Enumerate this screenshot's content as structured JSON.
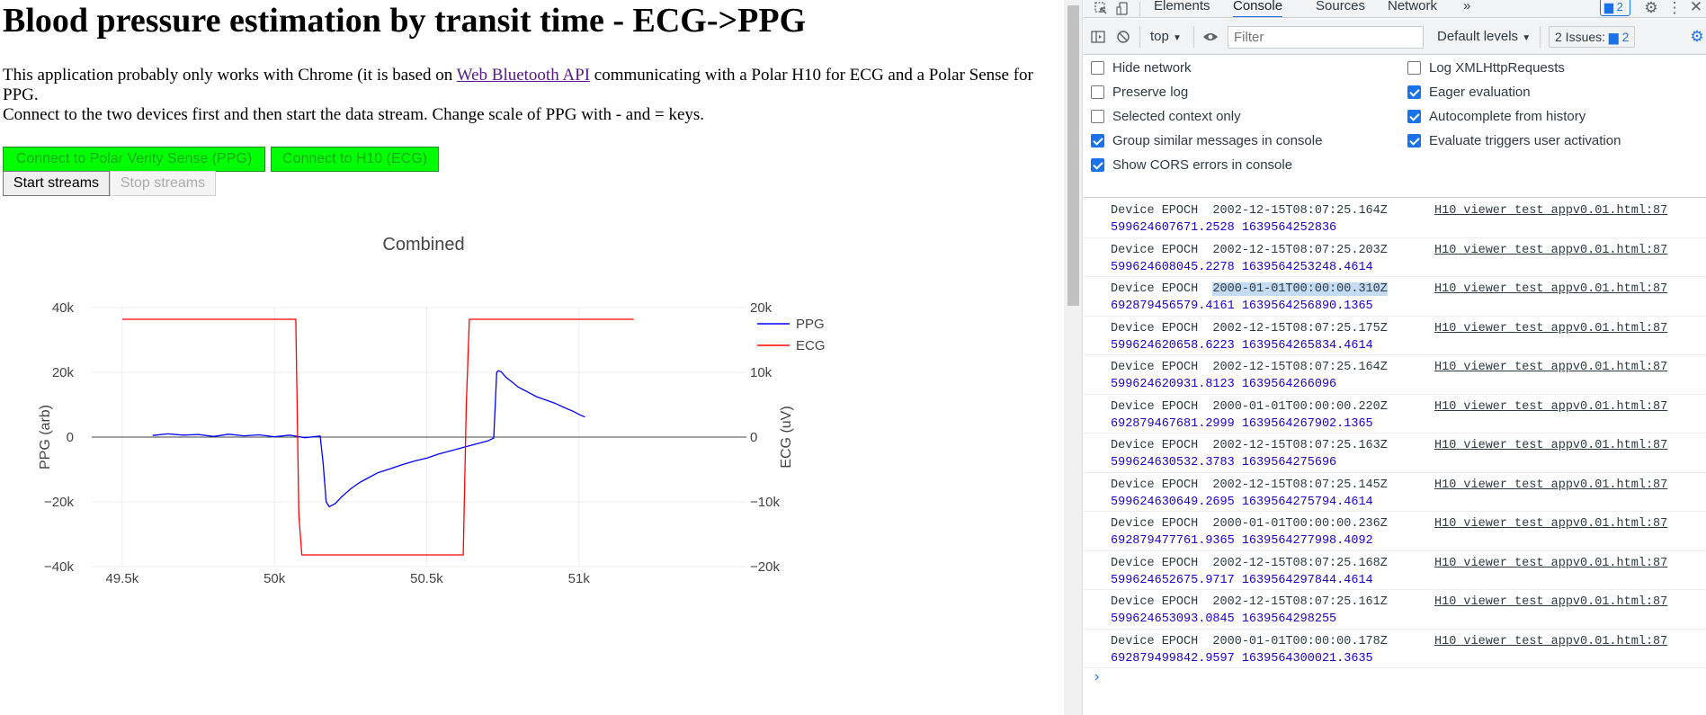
{
  "page": {
    "title": "Blood pressure estimation by transit time - ECG->PPG",
    "intro_part1": "This application probably only works with Chrome (it is based on ",
    "intro_link": "Web Bluetooth API",
    "intro_part2": " communicating with a Polar H10 for ECG and a Polar Sense for PPG.",
    "intro_line2": "Connect to the two devices first and then start the data stream. Change scale of PPG with - and = keys.",
    "btn_connect_ppg": "Connect to Polar Verity Sense (PPG)",
    "btn_connect_ecg": "Connect to H10 (ECG)",
    "btn_start": "Start streams",
    "btn_stop": "Stop streams",
    "accent_green": "#00ff00"
  },
  "chart_data": {
    "type": "line",
    "title": "Combined",
    "xlabel": "",
    "ylabel": "PPG (arb)",
    "y2label": "ECG (uV)",
    "xlim": [
      49400,
      51550
    ],
    "ylim": [
      -40000,
      40000
    ],
    "y2lim": [
      -20000,
      20000
    ],
    "x_ticks": [
      49500,
      50000,
      50500,
      51000
    ],
    "x_tick_labels": [
      "49.5k",
      "50k",
      "50.5k",
      "51k"
    ],
    "y_ticks": [
      -40000,
      -20000,
      0,
      20000,
      40000
    ],
    "y_tick_labels": [
      "−40k",
      "−20k",
      "0",
      "20k",
      "40k"
    ],
    "y2_ticks": [
      -20000,
      -10000,
      0,
      10000,
      20000
    ],
    "y2_tick_labels": [
      "−20k",
      "−10k",
      "0",
      "10k",
      "20k"
    ],
    "legend": "top-right",
    "series": [
      {
        "name": "PPG",
        "color": "#0000ff",
        "axis": "y",
        "x": [
          49600,
          49650,
          49700,
          49750,
          49800,
          49850,
          49900,
          49950,
          50000,
          50050,
          50100,
          50150,
          50160,
          50170,
          50180,
          50200,
          50220,
          50250,
          50280,
          50310,
          50340,
          50380,
          50420,
          50460,
          50500,
          50540,
          50580,
          50620,
          50660,
          50700,
          50720,
          50725,
          50730,
          50735,
          50745,
          50760,
          50780,
          50800,
          50830,
          50860,
          50890,
          50920,
          50950,
          50980,
          51000,
          51020
        ],
        "y": [
          500,
          1000,
          600,
          800,
          200,
          900,
          400,
          700,
          100,
          600,
          -200,
          300,
          -8000,
          -20000,
          -21500,
          -20500,
          -18500,
          -16000,
          -14000,
          -12500,
          -11000,
          -9800,
          -8500,
          -7400,
          -6500,
          -5200,
          -4200,
          -3200,
          -2200,
          -1200,
          -300,
          10000,
          20000,
          20500,
          20200,
          18500,
          17000,
          15500,
          14000,
          12500,
          11500,
          10500,
          9200,
          8000,
          7000,
          6200
        ]
      },
      {
        "name": "ECG",
        "color": "#ff0000",
        "axis": "y2",
        "x": [
          49500,
          50070,
          50080,
          50090,
          50620,
          50630,
          50640,
          51180
        ],
        "y": [
          18200,
          18200,
          -12000,
          -18200,
          -18200,
          5000,
          18200,
          18200
        ]
      }
    ]
  },
  "devtools": {
    "tabs": [
      "Elements",
      "Console",
      "Sources",
      "Network"
    ],
    "active_tab": "Console",
    "more_tabs": "»",
    "badge_count": "2",
    "context": "top",
    "filter_placeholder": "Filter",
    "levels": "Default levels",
    "issues_label": "2 Issues:",
    "issues_count": "2",
    "settings_left": [
      {
        "label": "Hide network",
        "checked": false
      },
      {
        "label": "Preserve log",
        "checked": false
      },
      {
        "label": "Selected context only",
        "checked": false
      },
      {
        "label": "Group similar messages in console",
        "checked": true
      },
      {
        "label": "Show CORS errors in console",
        "checked": true
      }
    ],
    "settings_right": [
      {
        "label": "Log XMLHttpRequests",
        "checked": false
      },
      {
        "label": "Eager evaluation",
        "checked": true
      },
      {
        "label": "Autocomplete from history",
        "checked": true
      },
      {
        "label": "Evaluate triggers user activation",
        "checked": true
      }
    ],
    "log_rows": [
      {
        "prefix": "Device EPOCH  ",
        "date": "2002-12-15T08:07:25.164Z",
        "values": "599624607671.2528 1639564252836",
        "source": "H10_viewer_test_appv0.01.html:87",
        "highlight": false
      },
      {
        "prefix": "Device EPOCH  ",
        "date": "2002-12-15T08:07:25.203Z",
        "values": "599624608045.2278 1639564253248.4614",
        "source": "H10_viewer_test_appv0.01.html:87",
        "highlight": false
      },
      {
        "prefix": "Device EPOCH  ",
        "date": "2000-01-01T00:00:00.310Z",
        "values": "692879456579.4161 1639564256890.1365",
        "source": "H10_viewer_test_appv0.01.html:87",
        "highlight": true
      },
      {
        "prefix": "Device EPOCH  ",
        "date": "2002-12-15T08:07:25.175Z",
        "values": "599624620658.6223 1639564265834.4614",
        "source": "H10_viewer_test_appv0.01.html:87",
        "highlight": false
      },
      {
        "prefix": "Device EPOCH  ",
        "date": "2002-12-15T08:07:25.164Z",
        "values": "599624620931.8123 1639564266096",
        "source": "H10_viewer_test_appv0.01.html:87",
        "highlight": false
      },
      {
        "prefix": "Device EPOCH  ",
        "date": "2000-01-01T00:00:00.220Z",
        "values": "692879467681.2999 1639564267902.1365",
        "source": "H10_viewer_test_appv0.01.html:87",
        "highlight": false
      },
      {
        "prefix": "Device EPOCH  ",
        "date": "2002-12-15T08:07:25.163Z",
        "values": "599624630532.3783 1639564275696",
        "source": "H10_viewer_test_appv0.01.html:87",
        "highlight": false
      },
      {
        "prefix": "Device EPOCH  ",
        "date": "2002-12-15T08:07:25.145Z",
        "values": "599624630649.2695 1639564275794.4614",
        "source": "H10_viewer_test_appv0.01.html:87",
        "highlight": false
      },
      {
        "prefix": "Device EPOCH  ",
        "date": "2000-01-01T00:00:00.236Z",
        "values": "692879477761.9365 1639564277998.4092",
        "source": "H10_viewer_test_appv0.01.html:87",
        "highlight": false
      },
      {
        "prefix": "Device EPOCH  ",
        "date": "2002-12-15T08:07:25.168Z",
        "values": "599624652675.9717 1639564297844.4614",
        "source": "H10_viewer_test_appv0.01.html:87",
        "highlight": false
      },
      {
        "prefix": "Device EPOCH  ",
        "date": "2002-12-15T08:07:25.161Z",
        "values": "599624653093.0845 1639564298255",
        "source": "H10_viewer_test_appv0.01.html:87",
        "highlight": false
      },
      {
        "prefix": "Device EPOCH  ",
        "date": "2000-01-01T00:00:00.178Z",
        "values": "692879499842.9597 1639564300021.3635",
        "source": "H10_viewer_test_appv0.01.html:87",
        "highlight": false
      }
    ],
    "prompt_symbol": "›"
  }
}
